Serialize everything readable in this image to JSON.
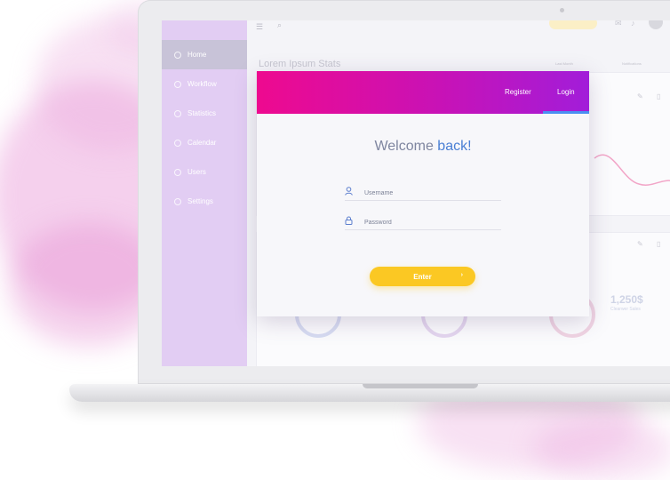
{
  "sidebar": {
    "items": [
      {
        "label": "Home",
        "active": true
      },
      {
        "label": "Workflow"
      },
      {
        "label": "Statistics"
      },
      {
        "label": "Calendar"
      },
      {
        "label": "Users"
      },
      {
        "label": "Settings"
      }
    ]
  },
  "dashboard": {
    "title": "Lorem Ipsum Stats",
    "filter_1": "Last Month",
    "filter_2": "Notifications",
    "stat_value": "1,250$",
    "stat_caption": "Clearwer Sales"
  },
  "modal": {
    "tabs": [
      {
        "label": "Register"
      },
      {
        "label": "Login",
        "active": true
      }
    ],
    "welcome_prefix": "Welcome ",
    "welcome_accent": "back!",
    "username_placeholder": "Username",
    "password_placeholder": "Password",
    "enter_label": "Enter",
    "enter_arrow": "›"
  },
  "colors": {
    "header_gradient": [
      "#ee0a8f",
      "#a21dd9"
    ],
    "tab_indicator": "#4a8ff2",
    "button": "#fbc823",
    "accent_text": "#4a7fd4",
    "sidebar": "#e2cdf3"
  },
  "icons": [
    "menu-icon",
    "search-icon",
    "mail-icon",
    "bell-icon",
    "user-icon",
    "lock-icon",
    "pencil-icon",
    "trash-icon"
  ]
}
